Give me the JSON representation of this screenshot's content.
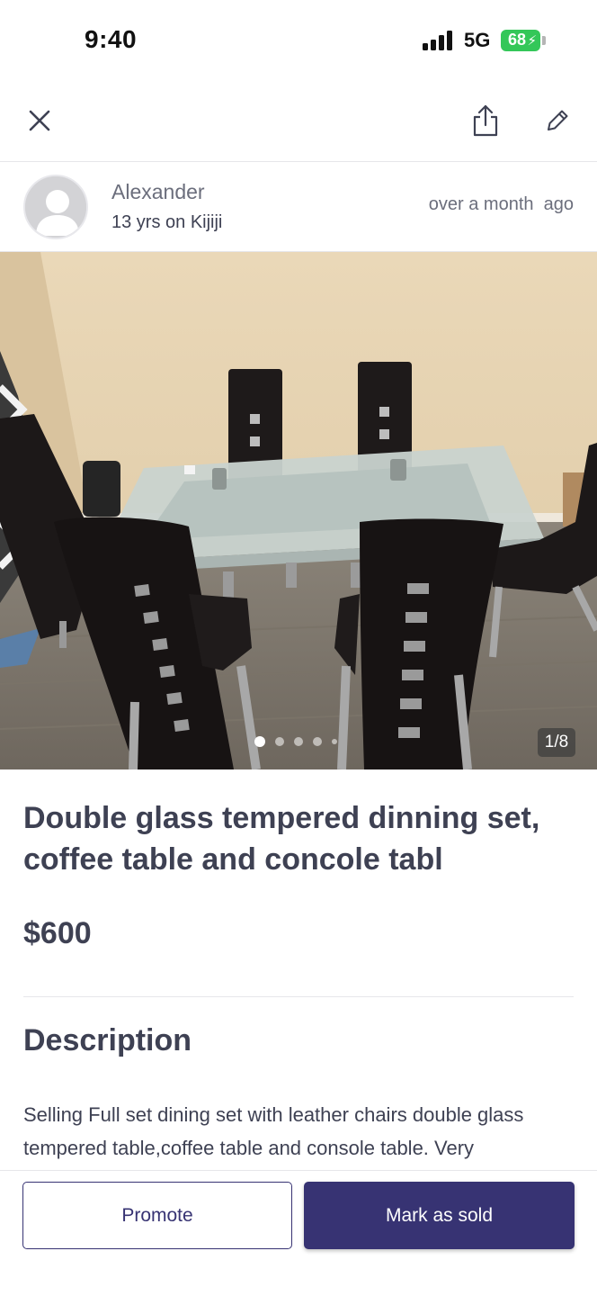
{
  "status_bar": {
    "time": "9:40",
    "network": "5G",
    "battery": "68",
    "battery_color": "#34c759"
  },
  "toolbar": {
    "close_icon": "close-icon",
    "share_icon": "share-icon",
    "edit_icon": "edit-pencil-icon"
  },
  "seller": {
    "name": "Alexander",
    "tenure": "13 yrs on Kijiji",
    "posted": "over a month  ago",
    "avatar_icon": "default-avatar-icon"
  },
  "gallery": {
    "counter": "1/8",
    "current_index": 1,
    "dot_count": 5
  },
  "listing": {
    "title": "Double glass tempered dinning set, coffee table and concole tabl",
    "price": "$600"
  },
  "description": {
    "heading": "Description",
    "body": "Selling Full set dining set with leather chairs double glass tempered table,coffee table and console table. Very"
  },
  "actions": {
    "promote_label": "Promote",
    "mark_sold_label": "Mark as sold"
  },
  "colors": {
    "brand_primary": "#373373",
    "text_primary": "#3e4153",
    "text_secondary": "#6b6e7c"
  }
}
